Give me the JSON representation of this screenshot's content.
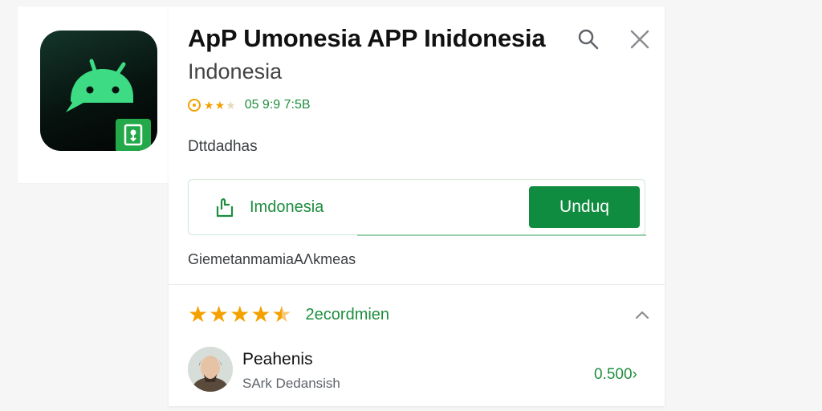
{
  "app": {
    "title": "ApP Umonesia APP Inidonesia",
    "subtitle": "Indonesia",
    "rating_stats": "05 9:9 7:5B",
    "details_label": "Dttdadhas",
    "info_text": "GiemetanmamiaΑΛkmeas"
  },
  "actions": {
    "share_label": "Imdonesia",
    "install_label": "Unduq"
  },
  "reviews": {
    "stars": 4.5,
    "count_label": "2ecordmien",
    "reviewer": {
      "name": "Peahenis",
      "subtitle": "SArk Dedansish",
      "value": "0.500›"
    }
  },
  "icons": {
    "search": "search-icon",
    "close": "close-icon",
    "share": "share-icon",
    "chevron": "chevron-up-icon",
    "android": "android-logo-icon"
  },
  "colors": {
    "accent": "#0f8c3f",
    "accent_text": "#1e8e3e",
    "star": "#f4a100",
    "icon_bg": "#07130f",
    "android_green": "#3ddc84"
  }
}
